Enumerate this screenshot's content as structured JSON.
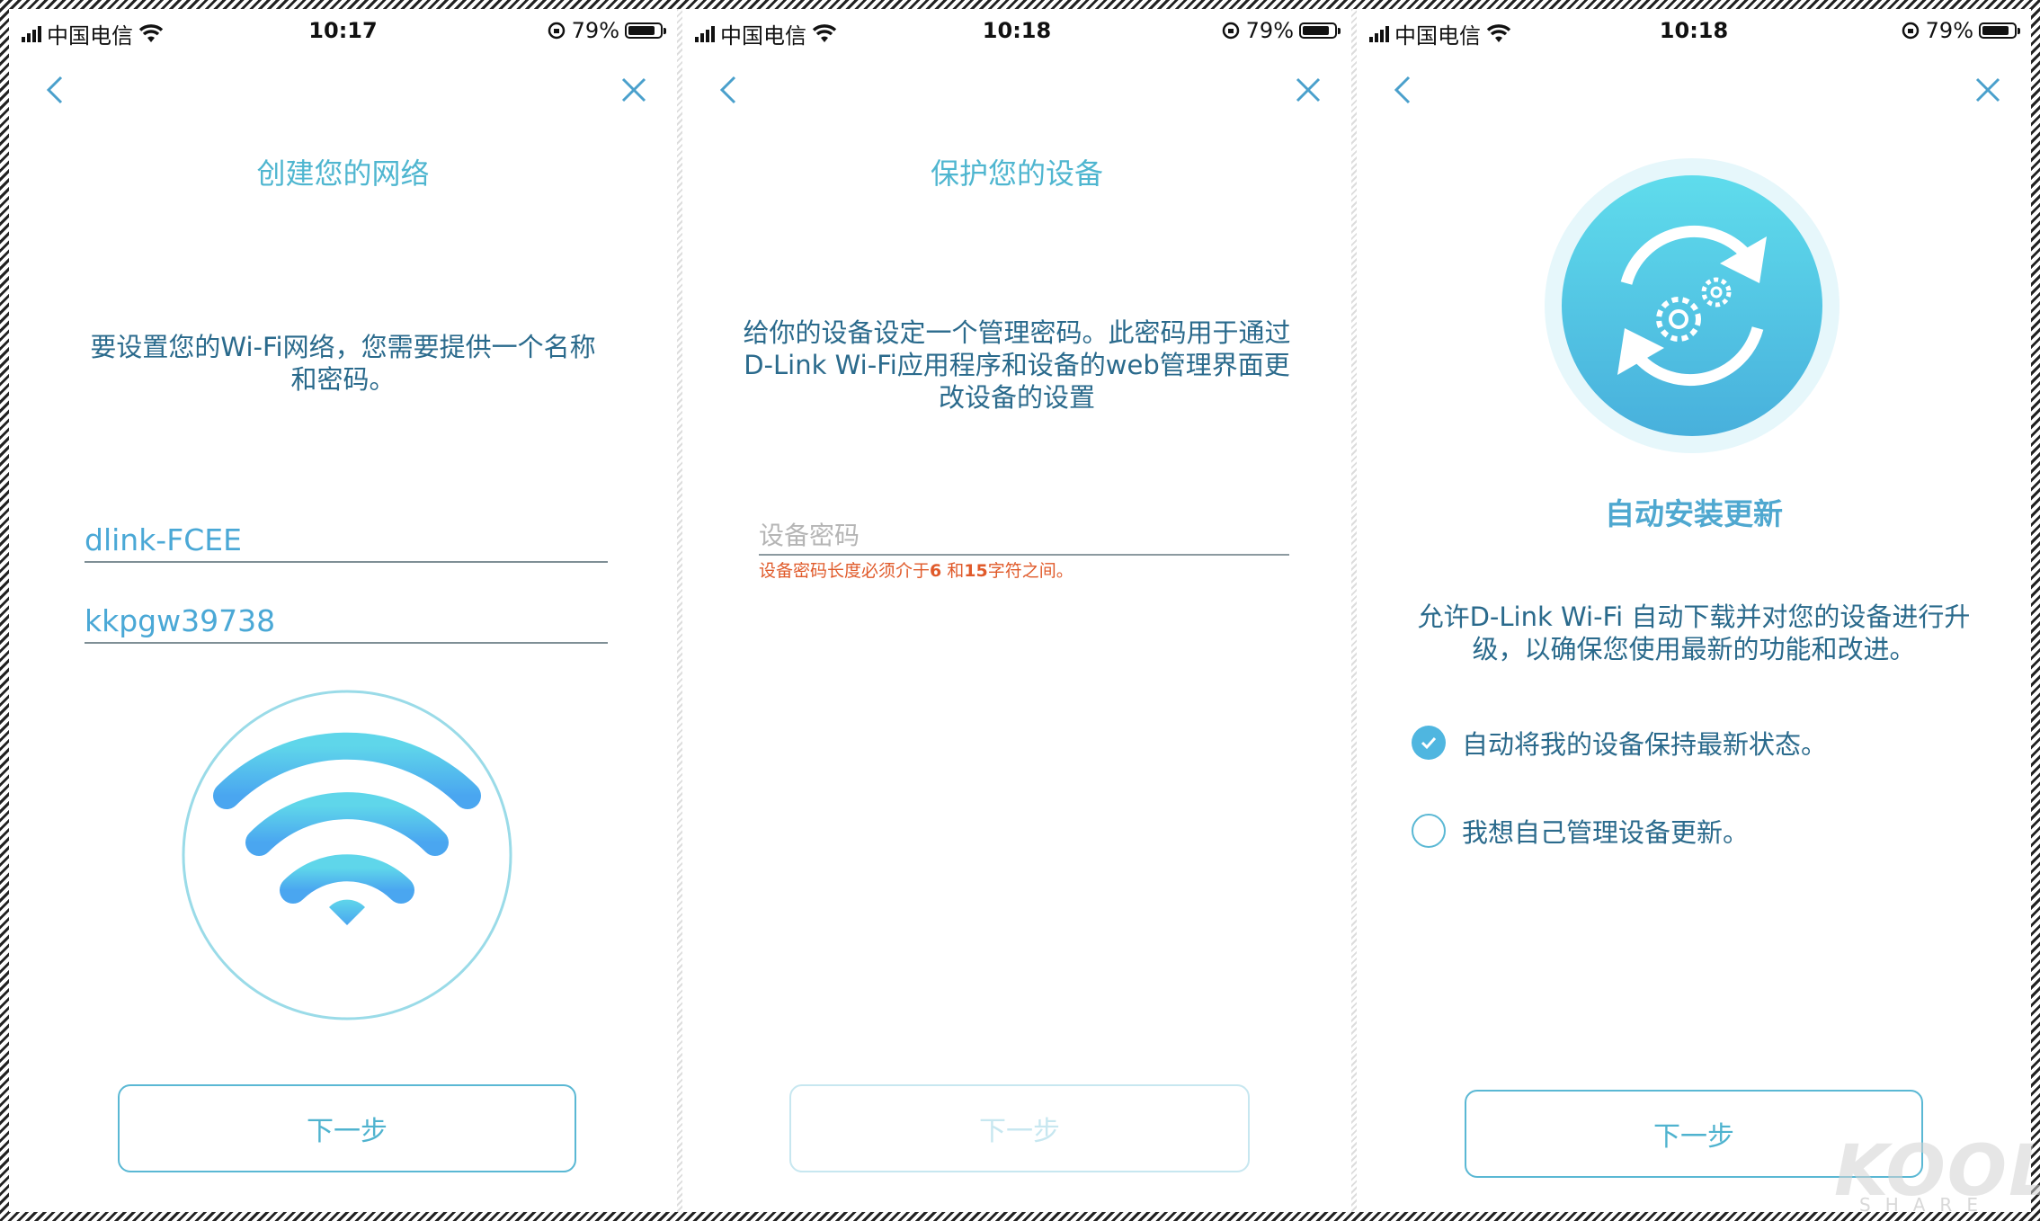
{
  "status": {
    "carrier": "中国电信",
    "battery": "79%",
    "time1": "10:17",
    "time2": "10:18",
    "time3": "10:18"
  },
  "screen1": {
    "title": "创建您的网络",
    "desc_line1": "要设置您的Wi-Fi网络，您需要提供一个名称",
    "desc_line2": "和密码。",
    "ssid": "dlink-FCEE",
    "password": "kkpgw39738",
    "next": "下一步"
  },
  "screen2": {
    "title": "保护您的设备",
    "desc_line1": "给你的设备设定一个管理密码。此密码用于通过",
    "desc_line2": "D-Link Wi-Fi应用程序和设备的web管理界面更",
    "desc_line3": "改设备的设置",
    "placeholder": "设备密码",
    "err_a": "设备密码长度必须介于",
    "err_n1": "6",
    "err_b": " 和",
    "err_n2": "15",
    "err_c": "字符之间。",
    "next": "下一步"
  },
  "screen3": {
    "title": "自动安装更新",
    "desc_line1": "允许D-Link Wi-Fi 自动下载并对您的设备进行升",
    "desc_line2": "级，以确保您使用最新的功能和改进。",
    "option_auto": "自动将我的设备保持最新状态。",
    "option_manual": "我想自己管理设备更新。",
    "option_auto_selected": true,
    "next": "下一步"
  },
  "watermark": {
    "logo": "KOOL",
    "sub": "SHARE"
  },
  "colors": {
    "accent": "#4fb6d0",
    "text": "#2a6a8c",
    "error": "#e05a2a"
  }
}
